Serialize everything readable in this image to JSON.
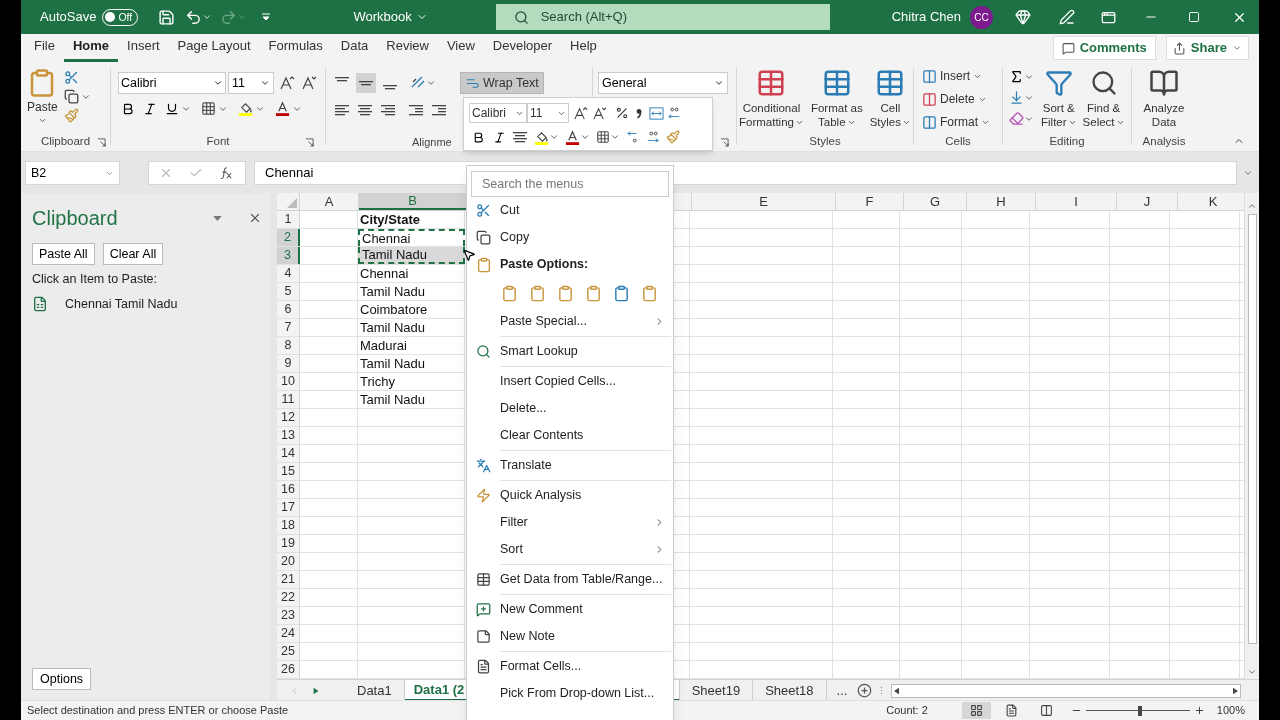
{
  "title_bar": {
    "autosave": "AutoSave",
    "autosave_on": false,
    "toggle_label": "Off",
    "title": "Workbook",
    "search_placeholder": "Search (Alt+Q)",
    "user": "Chitra Chen",
    "initials": "CC"
  },
  "tabs": [
    {
      "label": "File",
      "selected": false
    },
    {
      "label": "Home",
      "selected": true
    },
    {
      "label": "Insert",
      "selected": false
    },
    {
      "label": "Page Layout",
      "selected": false
    },
    {
      "label": "Formulas",
      "selected": false
    },
    {
      "label": "Data",
      "selected": false
    },
    {
      "label": "Review",
      "selected": false
    },
    {
      "label": "View",
      "selected": false
    },
    {
      "label": "Developer",
      "selected": false
    },
    {
      "label": "Help",
      "selected": false
    }
  ],
  "comments": "Comments",
  "share": "Share",
  "ribbon": {
    "clipboard": {
      "paste": "Paste",
      "label": "Clipboard"
    },
    "font": {
      "name": "Calibri",
      "size": "11",
      "label": "Font"
    },
    "alignment": {
      "wrap": "Wrap Text",
      "wrap_on": true,
      "label": "Alignme"
    },
    "number": {
      "format": "General"
    },
    "styles": {
      "buttons": [
        [
          "Conditional",
          "Formatting"
        ],
        [
          "Format as",
          "Table"
        ],
        [
          "Cell",
          "Styles"
        ]
      ],
      "label": "Styles"
    },
    "cells": {
      "buttons": [
        "Insert",
        "Delete",
        "Format"
      ],
      "label": "Cells"
    },
    "editing": {
      "buttons": [
        [
          "Sort &",
          "Filter"
        ],
        [
          "Find &",
          "Select"
        ]
      ],
      "label": "Editing"
    },
    "analysis": {
      "buttons": [
        [
          "Analyze",
          "Data"
        ]
      ],
      "label": "Analysis"
    }
  },
  "mini_toolbar": {
    "font": "Calibri",
    "size": "11"
  },
  "formula_bar": {
    "name_box": "B2",
    "value": "Chennai"
  },
  "clipboard_pane": {
    "title": "Clipboard",
    "buttons": [
      "Paste All",
      "Clear All"
    ],
    "hint": "Click an Item to Paste:",
    "items": [
      "Chennai Tamil Nadu"
    ],
    "options": "Options"
  },
  "sheet": {
    "columns": [
      {
        "label": "A",
        "selected": false
      },
      {
        "label": "B",
        "selected": true
      },
      {
        "label": "E",
        "selected": false
      },
      {
        "label": "F",
        "selected": false
      },
      {
        "label": "G",
        "selected": false
      },
      {
        "label": "H",
        "selected": false
      },
      {
        "label": "I",
        "selected": false
      },
      {
        "label": "J",
        "selected": false
      },
      {
        "label": "K",
        "selected": false
      }
    ],
    "rows": [
      {
        "number": "1",
        "value": "City/State",
        "kind": "header",
        "selected": false,
        "shaded": false,
        "copied": false
      },
      {
        "number": "2",
        "value": "Chennai",
        "kind": "data",
        "selected": true,
        "shaded": false,
        "copied": true
      },
      {
        "number": "3",
        "value": "Tamil Nadu",
        "kind": "data",
        "selected": true,
        "shaded": true,
        "copied": true
      },
      {
        "number": "4",
        "value": "Chennai",
        "kind": "data",
        "selected": false,
        "shaded": false,
        "copied": false
      },
      {
        "number": "5",
        "value": "Tamil Nadu",
        "kind": "data",
        "selected": false,
        "shaded": false,
        "copied": false
      },
      {
        "number": "6",
        "value": "Coimbatore",
        "kind": "data",
        "selected": false,
        "shaded": false,
        "copied": false
      },
      {
        "number": "7",
        "value": "Tamil Nadu",
        "kind": "data",
        "selected": false,
        "shaded": false,
        "copied": false
      },
      {
        "number": "8",
        "value": "Madurai",
        "kind": "data",
        "selected": false,
        "shaded": false,
        "copied": false
      },
      {
        "number": "9",
        "value": "Tamil Nadu",
        "kind": "data",
        "selected": false,
        "shaded": false,
        "copied": false
      },
      {
        "number": "10",
        "value": "Trichy",
        "kind": "data",
        "selected": false,
        "shaded": false,
        "copied": false
      },
      {
        "number": "11",
        "value": "Tamil Nadu",
        "kind": "data",
        "selected": false,
        "shaded": false,
        "copied": false
      },
      {
        "number": "12",
        "selected": false
      },
      {
        "number": "13",
        "selected": false
      },
      {
        "number": "14",
        "selected": false
      },
      {
        "number": "15",
        "selected": false
      },
      {
        "number": "16",
        "selected": false
      },
      {
        "number": "17",
        "selected": false
      },
      {
        "number": "18",
        "selected": false
      },
      {
        "number": "19",
        "selected": false
      },
      {
        "number": "20",
        "selected": false
      },
      {
        "number": "21",
        "selected": false
      },
      {
        "number": "22",
        "selected": false
      },
      {
        "number": "23",
        "selected": false
      },
      {
        "number": "24",
        "selected": false
      },
      {
        "number": "25",
        "selected": false
      },
      {
        "number": "26",
        "selected": false
      }
    ]
  },
  "context_menu": {
    "search_placeholder": "Search the menus",
    "items": [
      {
        "kind": "item",
        "label": "Cut",
        "submenu": false
      },
      {
        "kind": "item",
        "label": "Copy",
        "submenu": false
      },
      {
        "kind": "heading",
        "label": "Paste Options:"
      },
      {
        "kind": "paste_icons"
      },
      {
        "kind": "item",
        "label": "Paste Special...",
        "submenu": true
      },
      {
        "kind": "separator"
      },
      {
        "kind": "item",
        "label": "Smart Lookup",
        "submenu": false
      },
      {
        "kind": "separator"
      },
      {
        "kind": "item",
        "label": "Insert Copied Cells...",
        "submenu": false
      },
      {
        "kind": "item",
        "label": "Delete...",
        "submenu": false
      },
      {
        "kind": "item",
        "label": "Clear Contents",
        "submenu": false
      },
      {
        "kind": "separator"
      },
      {
        "kind": "item",
        "label": "Translate",
        "submenu": false
      },
      {
        "kind": "separator"
      },
      {
        "kind": "item",
        "label": "Quick Analysis",
        "submenu": false
      },
      {
        "kind": "item",
        "label": "Filter",
        "submenu": true
      },
      {
        "kind": "item",
        "label": "Sort",
        "submenu": true
      },
      {
        "kind": "separator"
      },
      {
        "kind": "item",
        "label": "Get Data from Table/Range...",
        "submenu": false
      },
      {
        "kind": "separator"
      },
      {
        "kind": "item",
        "label": "New Comment",
        "submenu": false
      },
      {
        "kind": "item",
        "label": "New Note",
        "submenu": false
      },
      {
        "kind": "separator"
      },
      {
        "kind": "item",
        "label": "Format Cells...",
        "submenu": false
      },
      {
        "kind": "item",
        "label": "Pick From Drop-down List...",
        "submenu": false
      }
    ]
  },
  "sheet_tabs": [
    {
      "label": "Data1",
      "selected": false
    },
    {
      "label": "Data1 (2",
      "selected": true
    },
    {
      "label": "Sheet19",
      "selected": false
    },
    {
      "label": "Sheet18",
      "selected": false
    }
  ],
  "more_sheets": "...",
  "status_bar": {
    "message": "Select destination and press ENTER or choose Paste",
    "count": "Count: 2",
    "zoom": "100%",
    "zoom_slider": {
      "level": 0.5
    }
  }
}
